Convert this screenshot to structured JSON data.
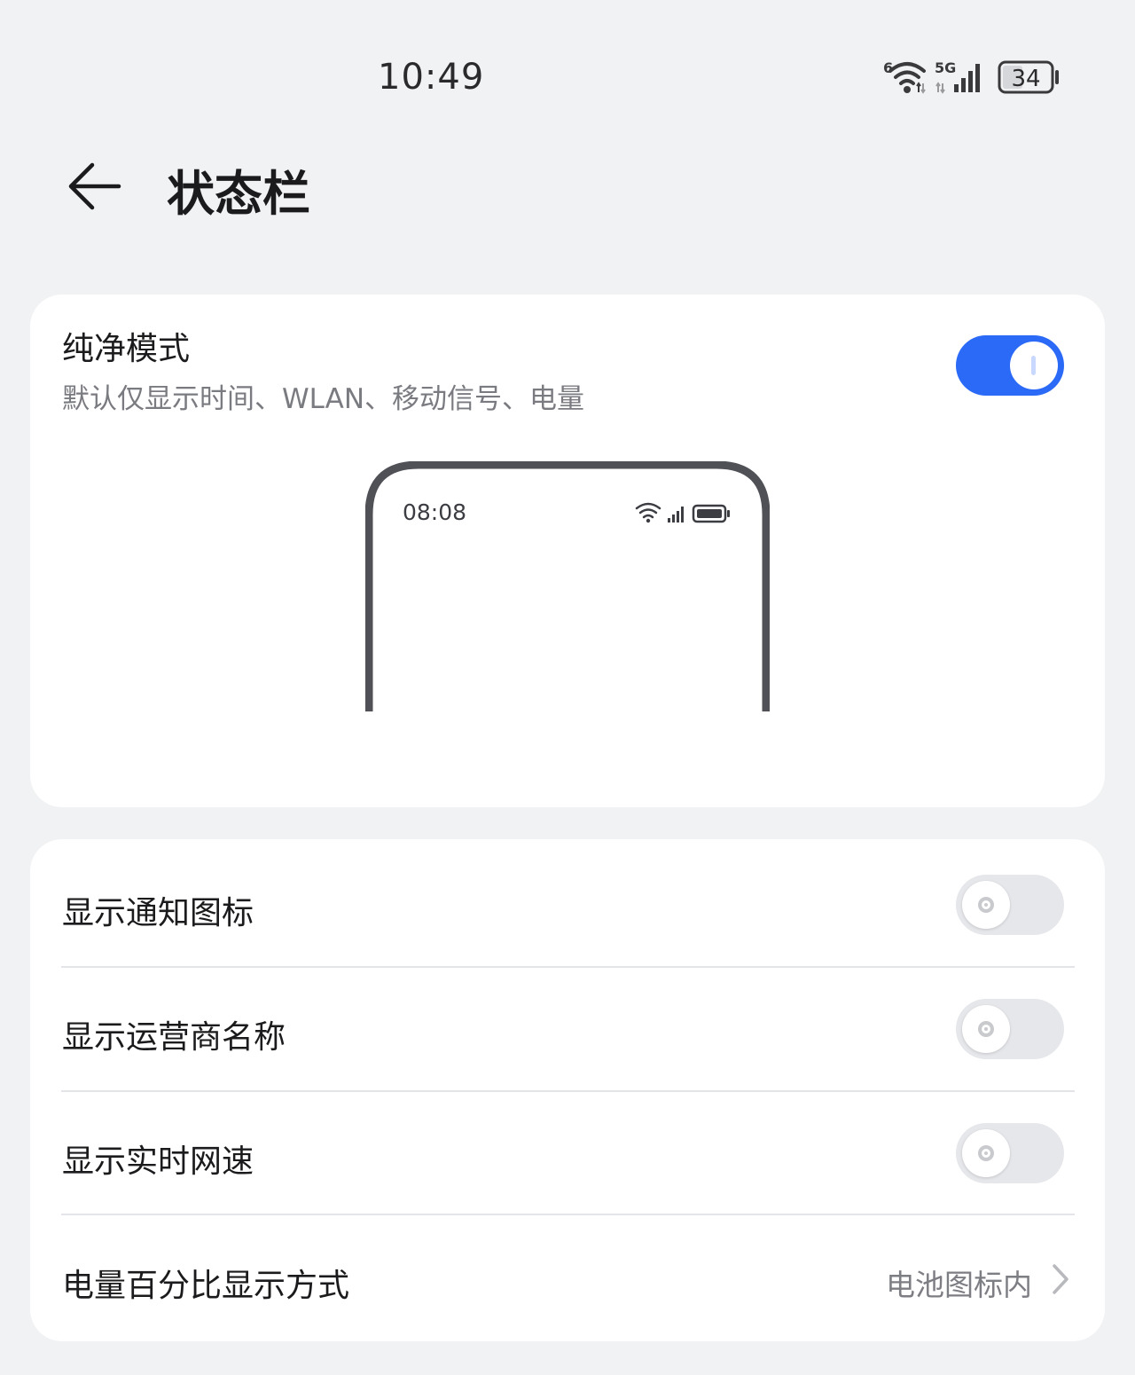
{
  "status_bar": {
    "time": "10:49",
    "wifi_badge": "6",
    "network_type": "5G",
    "battery_level": "34",
    "icons": [
      "wifi-icon",
      "cellular-signal-icon",
      "battery-icon"
    ]
  },
  "header": {
    "title": "状态栏",
    "back_icon": "arrow-left-icon"
  },
  "pure_mode": {
    "title": "纯净模式",
    "subtitle": "默认仅显示时间、WLAN、移动信号、电量",
    "enabled": true,
    "preview": {
      "time": "08:08",
      "icons": [
        "wifi-icon",
        "cellular-signal-icon",
        "battery-icon"
      ]
    }
  },
  "settings": [
    {
      "label": "显示通知图标",
      "enabled": false
    },
    {
      "label": "显示运营商名称",
      "enabled": false
    },
    {
      "label": "显示实时网速",
      "enabled": false
    }
  ],
  "battery_display": {
    "label": "电量百分比显示方式",
    "value": "电池图标内",
    "chevron_icon": "chevron-right-icon"
  },
  "colors": {
    "background": "#f1f2f4",
    "card": "#ffffff",
    "accent": "#2a6af6",
    "toggle_off": "#e6e7ea",
    "text_primary": "#1b1b1d",
    "text_secondary": "#7a7b80",
    "preview_frame": "#505157"
  }
}
